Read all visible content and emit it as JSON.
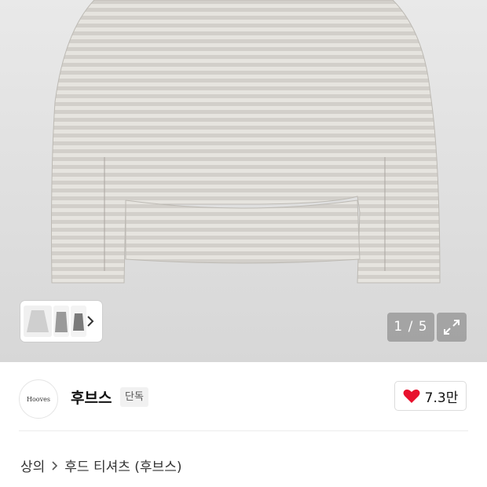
{
  "gallery": {
    "current_page": "1",
    "total_pages": "5",
    "counter_text": "1 / 5",
    "next_thumbs_icon": "chevron-right-icon",
    "expand_icon": "expand-icon"
  },
  "brand": {
    "logo_text": "Hooves",
    "name": "후브스",
    "badge": "단독",
    "likes": "7.3만",
    "like_icon": "heart-icon",
    "like_color": "#e8112d"
  },
  "breadcrumb": {
    "items": [
      "상의",
      "후드 티셔츠 (후브스)"
    ],
    "separator_icon": "chevron-right-icon"
  }
}
